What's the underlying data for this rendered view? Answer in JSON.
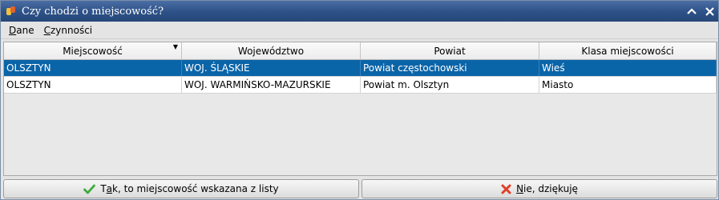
{
  "window": {
    "title": "Czy chodzi o miejscowość?",
    "colors": {
      "title_bar": "#2d5187",
      "selected_row": "#0a64a8"
    }
  },
  "menu": {
    "items": [
      {
        "accel": "D",
        "rest": "ane"
      },
      {
        "accel": "C",
        "rest": "zynności"
      }
    ]
  },
  "table": {
    "columns": [
      "Miejscowość",
      "Województwo",
      "Powiat",
      "Klasa miejscowości"
    ],
    "sorted_column": "Miejscowość",
    "selected_row": 0,
    "rows": [
      [
        "OLSZTYN",
        "WOJ. ŚLĄSKIE",
        "Powiat częstochowski",
        "Wieś"
      ],
      [
        "OLSZTYN",
        "WOJ. WARMIŃSKO-MAZURSKIE",
        "Powiat m. Olsztyn",
        "Miasto"
      ]
    ]
  },
  "buttons": {
    "yes": {
      "pre": "T",
      "accel": "a",
      "post": "k, to miejscowość wskazana z listy",
      "icon": "check-icon"
    },
    "no": {
      "pre": "",
      "accel": "N",
      "post": "ie, dziękuję",
      "icon": "cross-icon"
    }
  }
}
